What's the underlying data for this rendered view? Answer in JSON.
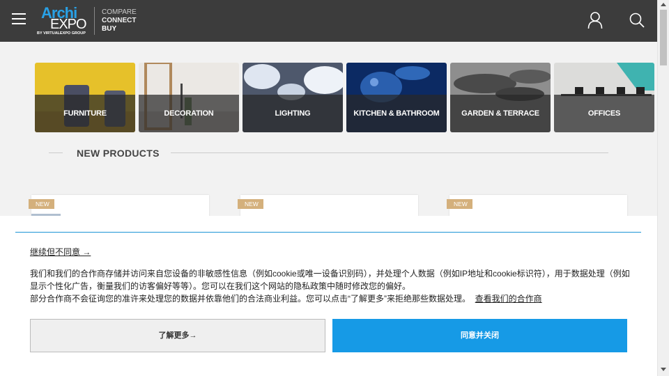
{
  "header": {
    "logo_archi": "Archi",
    "logo_expo": "EXPO",
    "logo_by": "BY VIRTUALEXPO GROUP",
    "tagline": [
      "COMPARE",
      "CONNECT",
      "BUY"
    ],
    "icons": [
      "menu-icon",
      "user-icon",
      "search-icon"
    ]
  },
  "categories": [
    {
      "label": "FURNITURE",
      "color": "#e6c12a"
    },
    {
      "label": "DECORATION",
      "color": "#e8e6e2"
    },
    {
      "label": "LIGHTING",
      "color": "#5a6478"
    },
    {
      "label": "KITCHEN & BATHROOM",
      "color": "#1d4a8e"
    },
    {
      "label": "GARDEN & TERRACE",
      "color": "#8a8a8a"
    },
    {
      "label": "OFFICES",
      "color": "#d6d8d6"
    }
  ],
  "new_products": {
    "title": "NEW PRODUCTS",
    "badges": [
      "NEW",
      "NEW",
      "NEW"
    ]
  },
  "cookie": {
    "reject_link": "继续但不同意 →",
    "text_line1": "我们和我们的合作商存储并访问来自您设备的非敏感性信息（例如cookie或唯一设备识别码），并处理个人数据（例如IP地址和cookie标识符），用于数据处理（例如显示个性化广告，衡量我们的访客偏好等等）。您可以在我们这个网站的隐私政策中随时修改您的偏好。",
    "text_line2": "部分合作商不会征询您的准许来处理您的数据并依靠他们的合法商业利益。您可以点击“了解更多”来拒绝那些数据处理。",
    "partners_link": "查看我们的合作商",
    "learn_more_button": "了解更多→",
    "agree_button": "同意并关闭"
  },
  "colors": {
    "header_bg": "#3c3c3c",
    "brand_blue": "#29a1e6",
    "agree_blue": "#169ae6",
    "badge": "#d4b07c"
  }
}
